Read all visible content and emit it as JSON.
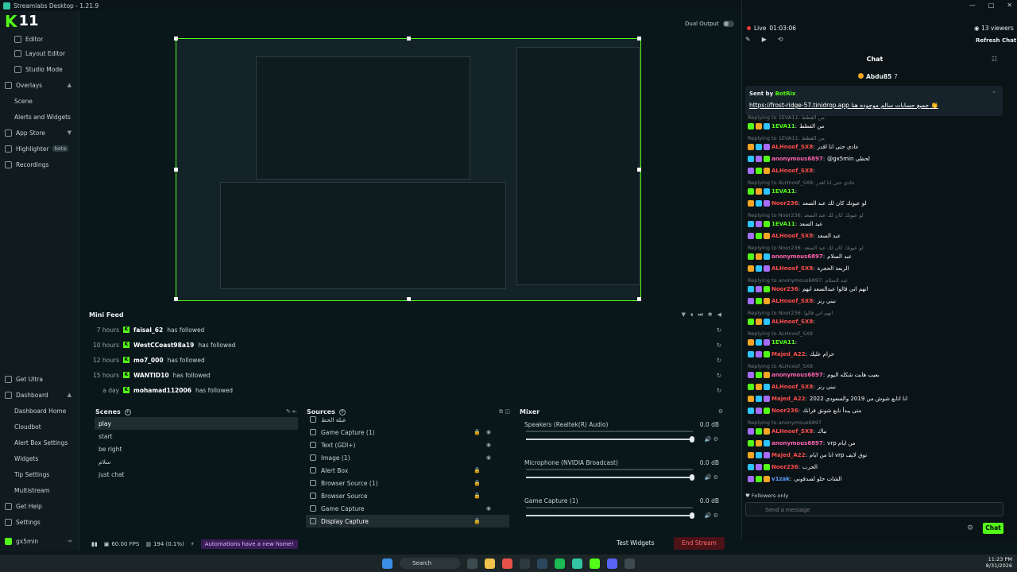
{
  "window": {
    "title": "Streamlabs Desktop - 1.21.9"
  },
  "channel_badge": "11",
  "sidebar": {
    "items": [
      {
        "label": "Editor"
      },
      {
        "label": "Layout Editor"
      },
      {
        "label": "Studio Mode"
      },
      {
        "label": "Overlays"
      },
      {
        "label": "Scene"
      },
      {
        "label": "Alerts and Widgets"
      },
      {
        "label": "App Store"
      },
      {
        "label": "Highlighter",
        "badge": "beta"
      },
      {
        "label": "Recordings"
      }
    ],
    "bottom_items": [
      {
        "label": "Get Ultra"
      },
      {
        "label": "Dashboard"
      },
      {
        "label": "Dashboard Home"
      },
      {
        "label": "Cloudbot"
      },
      {
        "label": "Alert Box Settings"
      },
      {
        "label": "Widgets"
      },
      {
        "label": "Tip Settings"
      },
      {
        "label": "Multistream"
      },
      {
        "label": "Get Help"
      },
      {
        "label": "Settings"
      },
      {
        "label": "gx5min"
      }
    ]
  },
  "dual_output": "Dual Output",
  "mini_feed": {
    "title": "Mini Feed",
    "rows": [
      {
        "time": "7 hours",
        "user": "faisal_62",
        "action": "has followed"
      },
      {
        "time": "10 hours",
        "user": "WestCCoast98a19",
        "action": "has followed"
      },
      {
        "time": "12 hours",
        "user": "mo7_000",
        "action": "has followed"
      },
      {
        "time": "15 hours",
        "user": "WANTID10",
        "action": "has followed"
      },
      {
        "time": "a day",
        "user": "mohamad112006",
        "action": "has followed"
      }
    ]
  },
  "scenes": {
    "title": "Scenes",
    "items": [
      "play",
      "start",
      "be right",
      "سلام",
      "just chat"
    ]
  },
  "sources": {
    "title": "Sources",
    "items": [
      "عبلة الحظ",
      "Game Capture (1)",
      "Text (GDI+)",
      "Image (1)",
      "Alert Box",
      "Browser Source (1)",
      "Browser Source",
      "Game Capture",
      "Display Capture"
    ]
  },
  "mixer": {
    "title": "Mixer",
    "channels": [
      {
        "name": "Speakers (Realtek(R) Audio)",
        "db": "0.0 dB"
      },
      {
        "name": "Microphone (NVIDIA Broadcast)",
        "db": "0.0 dB"
      },
      {
        "name": "Game Capture (1)",
        "db": "0.0 dB"
      }
    ]
  },
  "footer": {
    "fps": "60.00 FPS",
    "dropped": "194 (0.1%)",
    "notice": "Automations have a new home!",
    "test_widgets": "Test Widgets",
    "end_stream": "End Stream"
  },
  "chat": {
    "live": "Live",
    "uptime": "01:03:06",
    "viewers": "13 viewers",
    "refresh": "Refresh Chat",
    "title": "Chat",
    "gift_user": "Abdu85",
    "gift_count": "7",
    "pinned": {
      "sent_by": "Sent by",
      "bot": "BotRix",
      "link": "https://frost-ridge-57.tinidrop.app",
      "text": "جميع حسابات سالم موجوده هنا 👏"
    },
    "messages": [
      {
        "reply": "Replying to 1EVA11: من القطط",
        "user": "1EVA11",
        "color": "green",
        "text": "من القطط"
      },
      {
        "reply": "Replying to 1EVA11: من القطط",
        "user": "ALHnoof_SX8",
        "color": "red",
        "text": "عادي حتى انا اقدر"
      },
      {
        "reply": "",
        "user": "anonymous6897",
        "color": "pink",
        "text": "@gx5min لحظي"
      },
      {
        "reply": "",
        "user": "ALHnoof_SX8",
        "color": "red",
        "text": ""
      },
      {
        "reply": "Replying to ALHnoof_SX8: عادي حتى انا اقدر",
        "user": "1EVA11",
        "color": "green",
        "text": ""
      },
      {
        "reply": "",
        "user": "Noor236",
        "color": "red",
        "text": "لو عيونك كان لك عبد السعد"
      },
      {
        "reply": "Replying to Noor236: لو عيونك كان لك عبد السعد",
        "user": "1EVA11",
        "color": "green",
        "text": "عبد السعد"
      },
      {
        "reply": "",
        "user": "ALHnoof_SX8",
        "color": "red",
        "text": "عبد السعد"
      },
      {
        "reply": "Replying to Noor236: لو عيونك كان لك عبد السعد",
        "user": "anonymous6897",
        "color": "pink",
        "text": "عبد السلام"
      },
      {
        "reply": "",
        "user": "ALHnoof_SX8",
        "color": "red",
        "text": "الربعة الحجرة"
      },
      {
        "reply": "Replying to anonymous6897: عبد السلام",
        "user": "Noor236",
        "color": "red",
        "text": "انهم اتي قالوا عبدالسعد ابهم"
      },
      {
        "reply": "",
        "user": "ALHnoof_SX8",
        "color": "red",
        "text": "نبني رنز"
      },
      {
        "reply": "Replying to Noor236: انهم اتي قالوا",
        "user": "ALHnoof_SX8",
        "color": "red",
        "text": ""
      },
      {
        "reply": "Replying to ALHnoof_SX8",
        "user": "1EVA11",
        "color": "green",
        "text": ""
      },
      {
        "reply": "",
        "user": "Majed_A22",
        "color": "red",
        "text": "حرام عليك"
      },
      {
        "reply": "Replying to ALHnoof_SX8",
        "user": "anonymous6897",
        "color": "pink",
        "text": "بعيب هايت شكله اليوم"
      },
      {
        "reply": "",
        "user": "ALHnoof_SX8",
        "color": "red",
        "text": "نبني رنز"
      },
      {
        "reply": "",
        "user": "Majed_A22",
        "color": "red",
        "text": "انا اتابع شوش من 2019 والسعودي 2022"
      },
      {
        "reply": "",
        "user": "Noor236",
        "color": "red",
        "text": "متى يبدأ نابع شونق فرانك"
      },
      {
        "reply": "Replying to anonymous6897",
        "user": "ALHnoof_SX8",
        "color": "red",
        "text": "نباك"
      },
      {
        "reply": "",
        "user": "anonymous6897",
        "color": "pink",
        "text": "vrp من ايام"
      },
      {
        "reply": "",
        "user": "Majed_A22",
        "color": "red",
        "text": "انا من ايام vrp توق لايف"
      },
      {
        "reply": "",
        "user": "Noor236",
        "color": "red",
        "text": "الحرب"
      },
      {
        "reply": "",
        "user": "v1zak",
        "color": "blue",
        "text": "الشات حلو لصدقوني"
      }
    ],
    "followers_only": "Followers only",
    "input_placeholder": "Send a message",
    "send": "Chat"
  },
  "taskbar": {
    "search": "Search",
    "time": "11:23 PM",
    "date": "8/31/2026"
  }
}
